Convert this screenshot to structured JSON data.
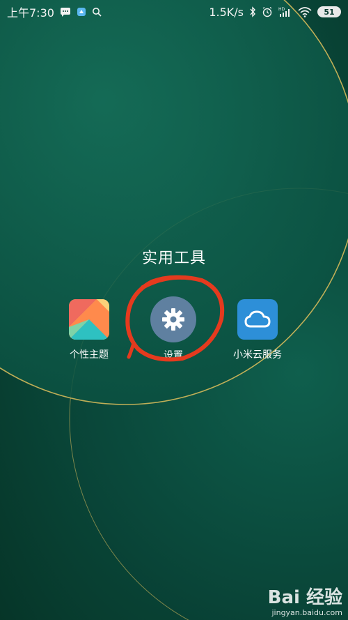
{
  "status_bar": {
    "time": "上午7:30",
    "network_speed": "1.5K/s",
    "battery_level": "51",
    "icons": [
      "message-icon",
      "app-notification-icon",
      "search-icon",
      "bluetooth-icon",
      "alarm-icon",
      "hd-signal-icon",
      "wifi-icon",
      "battery-icon"
    ]
  },
  "folder": {
    "title": "实用工具",
    "apps": [
      {
        "label": "个性主题",
        "icon": "themes-icon"
      },
      {
        "label": "设置",
        "icon": "gear-icon"
      },
      {
        "label": "小米云服务",
        "icon": "cloud-icon"
      }
    ]
  },
  "annotation": {
    "color": "#e53a1e",
    "target": "设置"
  },
  "watermark": {
    "brand": "Bai 经验",
    "url": "jingyan.baidu.com"
  }
}
